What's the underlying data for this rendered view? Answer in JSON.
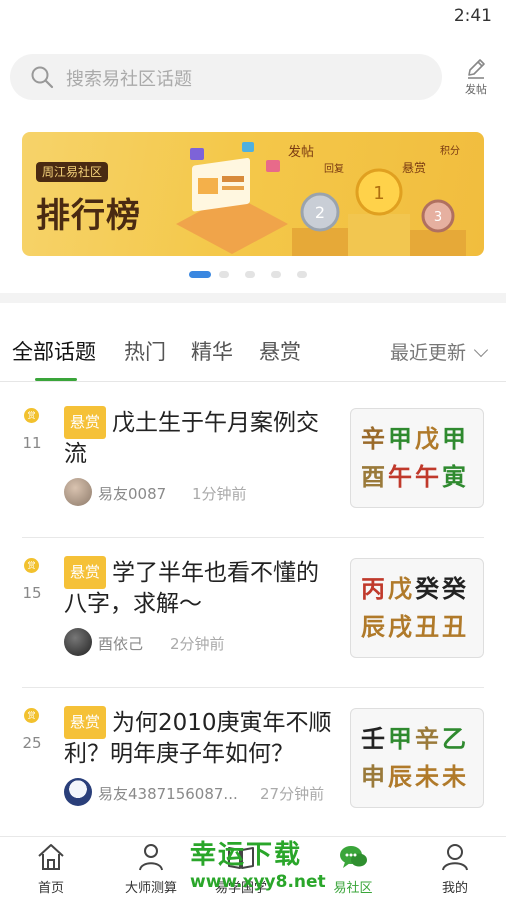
{
  "status": {
    "time": "2:41"
  },
  "search": {
    "placeholder": "搜索易社区话题",
    "post_label": "发帖"
  },
  "banner": {
    "logo_text": "周江易社区",
    "title": "排行榜",
    "labels": [
      "发帖",
      "回复",
      "悬赏",
      "积分"
    ]
  },
  "carousel": {
    "count": 5,
    "active": 0
  },
  "tabs": [
    {
      "label": "全部话题",
      "active": true
    },
    {
      "label": "热门",
      "active": false
    },
    {
      "label": "精华",
      "active": false
    },
    {
      "label": "悬赏",
      "active": false
    }
  ],
  "sort": {
    "label": "最近更新"
  },
  "posts": [
    {
      "reward_icon": "赏",
      "reward_count": "11",
      "badge": "悬赏",
      "title": "戊土生于午月案例交流",
      "author": "易友0087",
      "time": "1分钟前",
      "bazi": [
        [
          "辛",
          "甲",
          "戊",
          "甲"
        ],
        [
          "酉",
          "午",
          "午",
          "寅"
        ]
      ],
      "bazi_colors": [
        [
          "#b07a2a",
          "#2f8a2f",
          "#b07a2a",
          "#2f8a2f"
        ],
        [
          "#9a7a3a",
          "#c0392b",
          "#c0392b",
          "#2f8a2f"
        ]
      ]
    },
    {
      "reward_icon": "赏",
      "reward_count": "15",
      "badge": "悬赏",
      "title": "学了半年也看不懂的八字，求解～",
      "author": "酉依己",
      "time": "2分钟前",
      "bazi": [
        [
          "丙",
          "戊",
          "癸",
          "癸"
        ],
        [
          "辰",
          "戌",
          "丑",
          "丑"
        ]
      ],
      "bazi_colors": [
        [
          "#c0392b",
          "#b07a2a",
          "#222222",
          "#222222"
        ],
        [
          "#b07a2a",
          "#b07a2a",
          "#b07a2a",
          "#b07a2a"
        ]
      ]
    },
    {
      "reward_icon": "赏",
      "reward_count": "25",
      "badge": "悬赏",
      "title": "为何2010庚寅年不顺利？明年庚子年如何？",
      "author": "易友4387156087...",
      "time": "27分钟前",
      "bazi": [
        [
          "壬",
          "甲",
          "辛",
          "乙"
        ],
        [
          "申",
          "辰",
          "未",
          "未"
        ]
      ],
      "bazi_colors": [
        [
          "#222222",
          "#2f8a2f",
          "#9a7a3a",
          "#2f8a2f"
        ],
        [
          "#9a7a3a",
          "#b07a2a",
          "#b07a2a",
          "#b07a2a"
        ]
      ]
    }
  ],
  "watermark": {
    "title": "幸运下载",
    "url": "www.xyy8.net"
  },
  "nav": [
    {
      "label": "首页",
      "icon": "home-icon",
      "active": false
    },
    {
      "label": "大师测算",
      "icon": "master-icon",
      "active": false
    },
    {
      "label": "易学国学",
      "icon": "book-icon",
      "active": false
    },
    {
      "label": "易社区",
      "icon": "chat-icon",
      "active": true
    },
    {
      "label": "我的",
      "icon": "person-icon",
      "active": false
    }
  ],
  "colors": {
    "accent": "#3aa53a",
    "badge": "#f5c138",
    "banner": "#f4c84a"
  }
}
